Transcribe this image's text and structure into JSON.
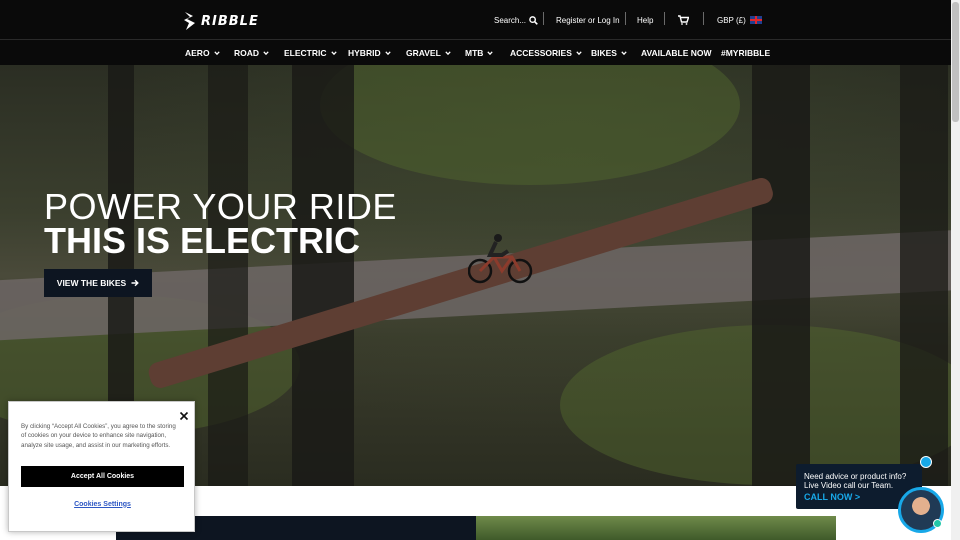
{
  "brand": {
    "logo_text": "RIBBLE"
  },
  "header": {
    "search_label": "Search...",
    "register_label": "Register or Log In",
    "help_label": "Help",
    "currency_label": "GBP (£)"
  },
  "nav": {
    "items": [
      {
        "label": "AERO",
        "has_dropdown": true
      },
      {
        "label": "ROAD",
        "has_dropdown": true
      },
      {
        "label": "ELECTRIC",
        "has_dropdown": true
      },
      {
        "label": "HYBRID",
        "has_dropdown": true
      },
      {
        "label": "GRAVEL",
        "has_dropdown": true
      },
      {
        "label": "MTB",
        "has_dropdown": true
      },
      {
        "label": "ACCESSORIES",
        "has_dropdown": true
      },
      {
        "label": "BIKES",
        "has_dropdown": true
      },
      {
        "label": "AVAILABLE NOW",
        "has_dropdown": false
      },
      {
        "label": "#MYRIBBLE",
        "has_dropdown": false
      }
    ]
  },
  "hero": {
    "headline_line1": "POWER YOUR RIDE",
    "headline_line2": "THIS IS ELECTRIC",
    "cta_label": "VIEW THE BIKES"
  },
  "cookie_banner": {
    "text": "By clicking “Accept All Cookies”, you agree to the storing of cookies on your device to enhance site navigation, analyze site usage, and assist in our marketing efforts.",
    "accept_label": "Accept All Cookies",
    "settings_label": "Cookies Settings"
  },
  "chat_widget": {
    "line1": "Need advice or product info?",
    "line2": "Live Video call our Team.",
    "cta_label": "CALL NOW >"
  },
  "colors": {
    "header_bg": "#0a0a0a",
    "cta_bg": "#0d1521",
    "chat_accent": "#18a8e8",
    "cookie_link": "#2d57c4"
  }
}
